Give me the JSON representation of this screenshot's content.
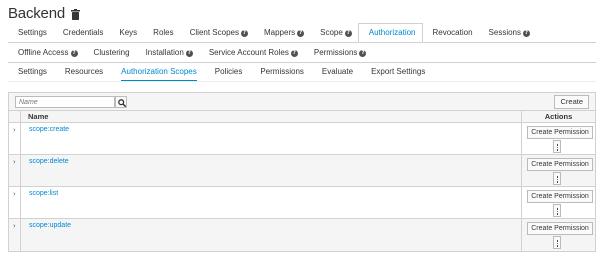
{
  "page": {
    "title": "Backend"
  },
  "tabs": [
    {
      "label": "Settings",
      "help": false,
      "active": false
    },
    {
      "label": "Credentials",
      "help": false,
      "active": false
    },
    {
      "label": "Keys",
      "help": false,
      "active": false
    },
    {
      "label": "Roles",
      "help": false,
      "active": false
    },
    {
      "label": "Client Scopes",
      "help": true,
      "active": false
    },
    {
      "label": "Mappers",
      "help": true,
      "active": false
    },
    {
      "label": "Scope",
      "help": true,
      "active": false
    },
    {
      "label": "Authorization",
      "help": false,
      "active": true
    },
    {
      "label": "Revocation",
      "help": false,
      "active": false
    },
    {
      "label": "Sessions",
      "help": true,
      "active": false
    },
    {
      "label": "Offline Access",
      "help": true,
      "active": false
    },
    {
      "label": "Clustering",
      "help": false,
      "active": false
    },
    {
      "label": "Installation",
      "help": true,
      "active": false
    },
    {
      "label": "Service Account Roles",
      "help": true,
      "active": false
    },
    {
      "label": "Permissions",
      "help": true,
      "active": false
    }
  ],
  "subtabs": [
    {
      "label": "Settings",
      "active": false
    },
    {
      "label": "Resources",
      "active": false
    },
    {
      "label": "Authorization Scopes",
      "active": true
    },
    {
      "label": "Policies",
      "active": false
    },
    {
      "label": "Permissions",
      "active": false
    },
    {
      "label": "Evaluate",
      "active": false
    },
    {
      "label": "Export Settings",
      "active": false
    }
  ],
  "toolbar": {
    "search_placeholder": "Name",
    "create_label": "Create"
  },
  "table": {
    "col_name": "Name",
    "col_actions": "Actions",
    "row_action_label": "Create Permission",
    "rows": [
      {
        "name": "scope:create"
      },
      {
        "name": "scope:delete"
      },
      {
        "name": "scope:list"
      },
      {
        "name": "scope:update"
      }
    ]
  },
  "icons": {
    "delete": "trash-icon",
    "help": "question-circle-icon",
    "search": "search-icon",
    "expand": "chevron-right-icon",
    "more": "kebab-icon"
  },
  "colors": {
    "accent": "#0088ce",
    "text": "#363636",
    "border": "#d1d1d1",
    "header_bg": "#f5f5f5"
  }
}
